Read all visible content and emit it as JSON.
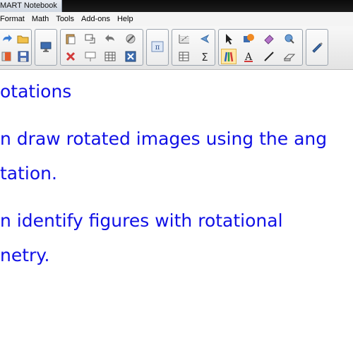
{
  "window": {
    "title": "MART Notebook"
  },
  "menu": {
    "items": [
      "Format",
      "Math",
      "Tools",
      "Add-ons",
      "Help"
    ]
  },
  "toolbar": {
    "icons": [
      "redo-icon",
      "open-folder-icon",
      "screen-shade-icon",
      "paste-icon",
      "undo-icon",
      "gallery-icon",
      "math-pi-icon",
      "table-icon",
      "select-arrow-icon",
      "fill-icon",
      "eraser-icon",
      "measure-icon",
      "save-icon",
      "delete-icon",
      "table-icon",
      "clear-icon",
      "grid-icon",
      "sum-icon",
      "pens-icon",
      "text-icon",
      "line-icon",
      "shape-icon",
      "pen-icon"
    ]
  },
  "page": {
    "lines": [
      "otations",
      "n draw rotated images using the ang",
      "tation.",
      "n identify figures with rotational",
      "netry."
    ]
  },
  "colors": {
    "text": "#1010e6",
    "title_bar": "#111111"
  }
}
